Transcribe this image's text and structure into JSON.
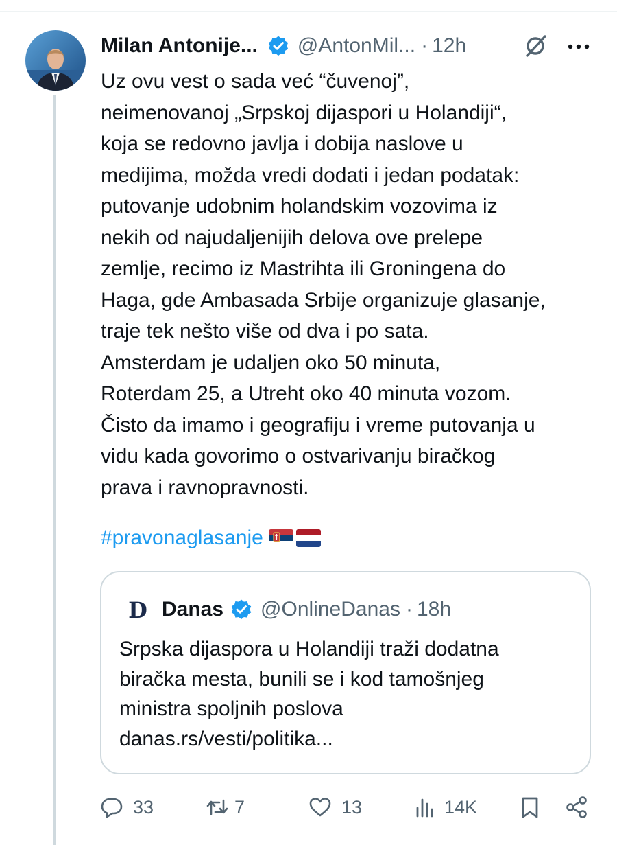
{
  "tweet": {
    "author_name": "Milan Antonije...",
    "handle": "@AntonMil...",
    "time": "12h",
    "text_lines": [
      "Uz ovu vest o sada već “čuvenoj”,",
      "neimenovanoj „Srpskoj dijaspori u Holandiji“,",
      "koja se redovno javlja i dobija naslove u",
      "medijima, možda vredi dodati i jedan podatak:",
      "putovanje udobnim holandskim vozovima iz",
      "nekih od najudaljenijih delova ove prelepe",
      "zemlje, recimo iz Mastrihta ili Groningena do",
      "Haga, gde Ambasada Srbije organizuje glasanje,",
      "traje tek nešto više od dva i po sata.",
      "Amsterdam je udaljen oko 50 minuta,",
      "Roterdam 25, a Utreht oko 40 minuta vozom.",
      "Čisto da imamo i geografiju i vreme putovanja u",
      "vidu kada govorimo o ostvarivanju biračkog",
      "prava i ravnopravnosti."
    ],
    "hashtag": "#pravonaglasanje",
    "flags": [
      "serbia-flag",
      "netherlands-flag"
    ]
  },
  "quote": {
    "author_name": "Danas",
    "handle": "@OnlineDanas",
    "time": "18h",
    "logo_letter": "D",
    "text_lines": [
      "Srpska dijaspora u Holandiji traži dodatna",
      "birAčka mesta, bunili se i kod tamošnjeg",
      "ministra spoljnih poslova",
      "danas.rs/vesti/politika..."
    ]
  },
  "actions": {
    "replies": "33",
    "reposts": "7",
    "likes": "13",
    "views": "14K"
  },
  "separator": "·",
  "colors": {
    "text": "#0f1419",
    "secondary": "#536471",
    "link": "#1d9bf0",
    "border": "#cfd9de"
  }
}
